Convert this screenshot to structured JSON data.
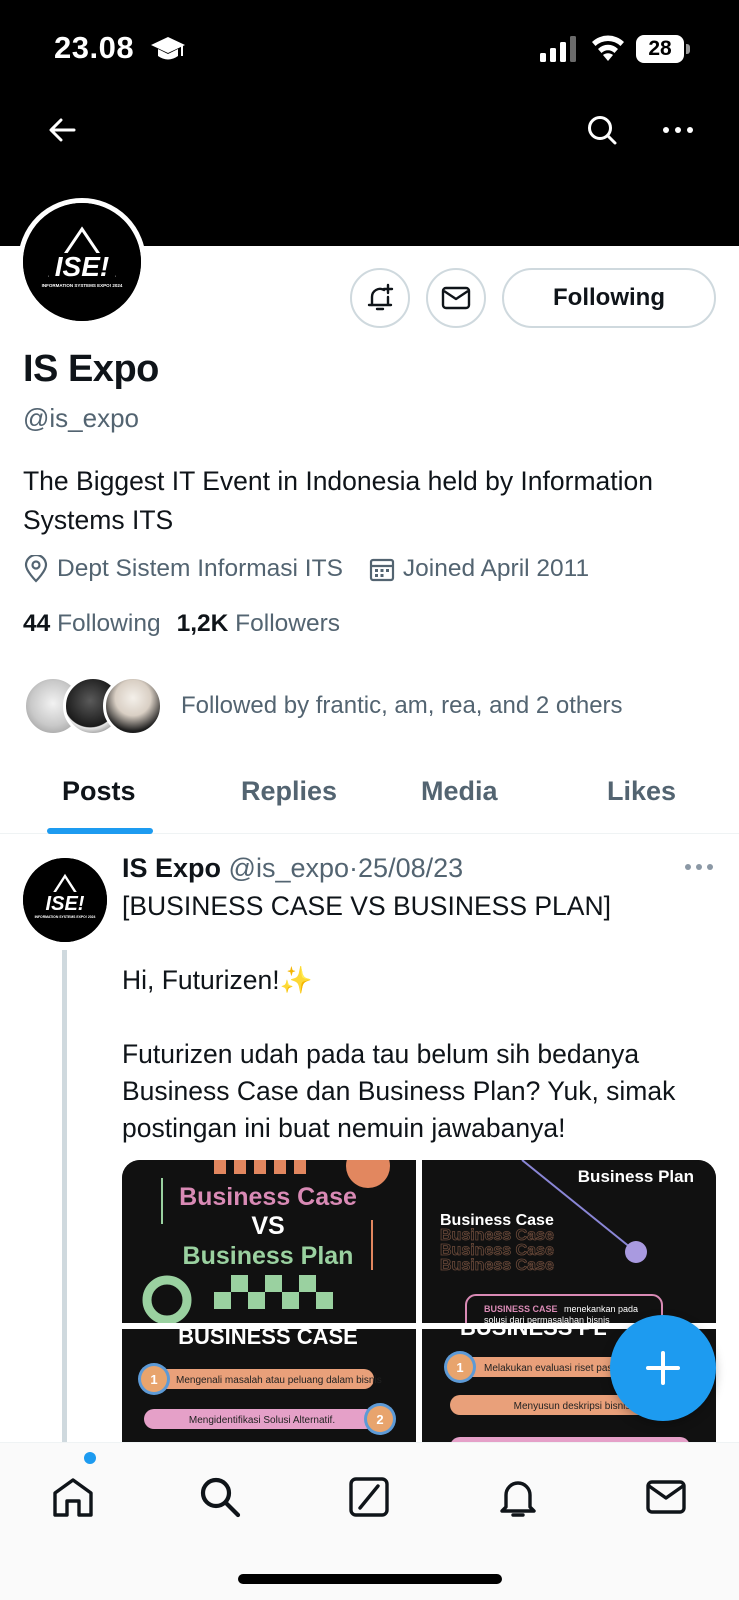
{
  "status_bar": {
    "time": "23.08",
    "battery": "28"
  },
  "header": {
    "back_icon": "arrow-left-icon",
    "search_icon": "search-icon",
    "more_icon": "more-horizontal-icon"
  },
  "profile": {
    "logo_text": "ISE!",
    "logo_subtext": "INFORMATION SYSTEMS EXPO! 2024",
    "display_name": "IS Expo",
    "handle": "@is_expo",
    "bio": "The Biggest IT Event in Indonesia held by Information Systems ITS",
    "location": "Dept Sistem Informasi ITS",
    "joined": "Joined April 2011",
    "following_count": "44",
    "following_label": "Following",
    "followers_count": "1,2K",
    "followers_label": "Followers",
    "followed_by": "Followed by frantic, am, rea, and 2 others",
    "following_button": "Following"
  },
  "tabs": [
    {
      "label": "Posts",
      "active": true
    },
    {
      "label": "Replies",
      "active": false
    },
    {
      "label": "Media",
      "active": false
    },
    {
      "label": "Likes",
      "active": false
    }
  ],
  "post": {
    "author_name": "IS Expo",
    "author_handle": "@is_expo",
    "separator": "·",
    "date": "25/08/23",
    "line1": "[BUSINESS CASE VS BUSINESS PLAN]",
    "line2": "Hi, Futurizen!✨",
    "line3": "Futurizen udah pada tau belum sih bedanya Business Case dan Business Plan? Yuk, simak postingan ini buat nemuin jawabanya!",
    "media": {
      "tile1": {
        "line_a": "Business Case",
        "line_b": "VS",
        "line_c": "Business Plan"
      },
      "tile2": {
        "top": "Business Plan",
        "mid": "Business Case",
        "echo": "Business Case",
        "note_a": "BUSINESS CASE",
        "note_b": "menekankan pada",
        "note_c": "solusi   dari   permasalahan   bisnis"
      },
      "tile3": {
        "title": "BUSINESS CASE",
        "item1_num": "1",
        "item1": "Mengenali masalah atau peluang dalam bisnis",
        "item2": "Mengidentifikasi Solusi Alternatif.",
        "item2_num": "2"
      },
      "tile4": {
        "title": "BUSINESS PL",
        "item1_num": "1",
        "item1": "Melakukan evaluasi riset pas",
        "item2": "Menyusun deskripsi bisnis"
      }
    }
  },
  "bottom_nav": [
    {
      "icon": "home-icon"
    },
    {
      "icon": "search-icon"
    },
    {
      "icon": "grok-icon"
    },
    {
      "icon": "bell-icon"
    },
    {
      "icon": "mail-icon"
    }
  ],
  "colors": {
    "accent": "#1d9bf0",
    "text_primary": "#0f1419",
    "text_secondary": "#536471",
    "border": "#cfd9de",
    "banner": "#000000"
  }
}
